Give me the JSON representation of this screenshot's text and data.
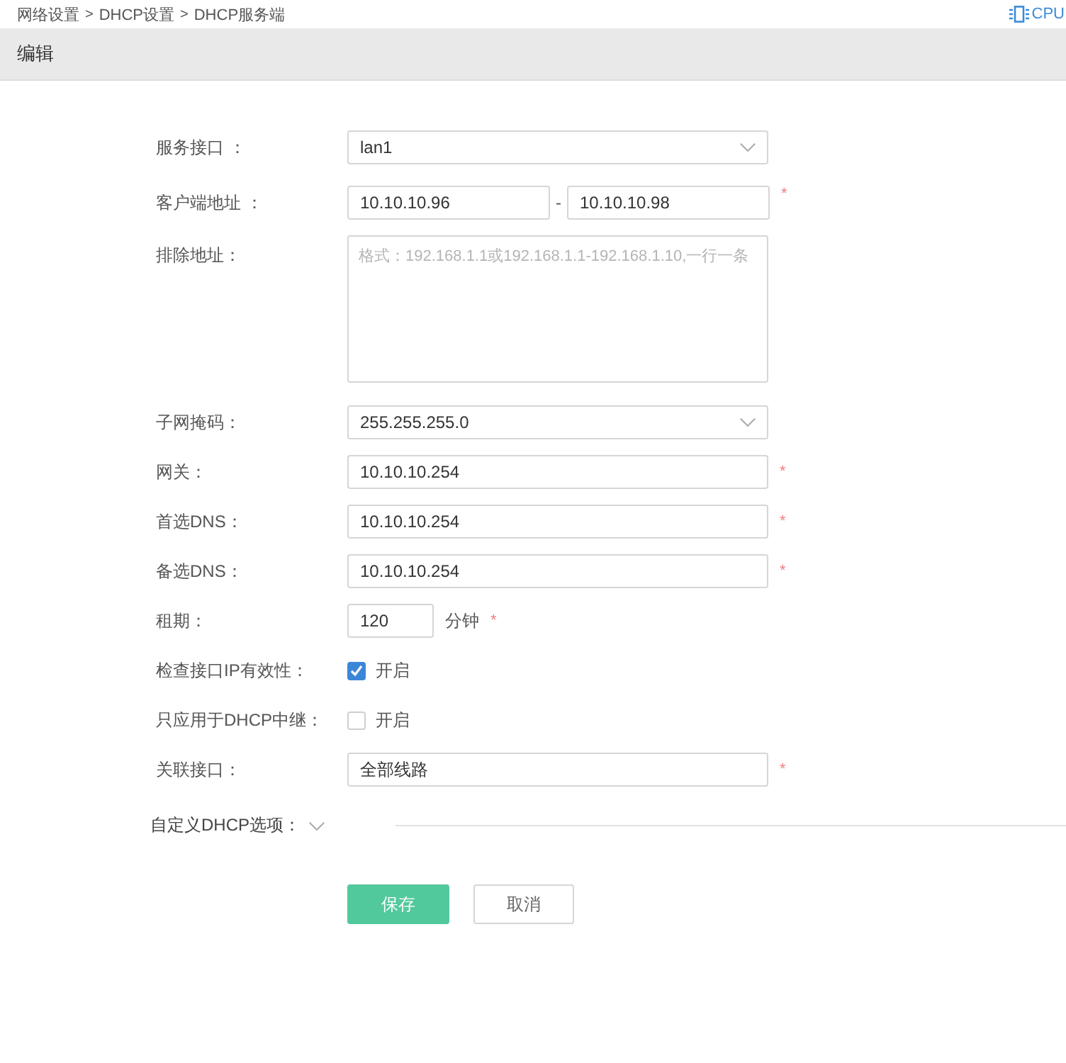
{
  "breadcrumb": {
    "items": [
      "网络设置",
      "DHCP设置",
      "DHCP服务端"
    ],
    "separator": ">"
  },
  "status": {
    "label": "CPU"
  },
  "header": {
    "title": "编辑"
  },
  "form": {
    "rows": [
      {
        "kind": "select",
        "label": "服务接口 ：",
        "value": "lan1"
      },
      {
        "kind": "range",
        "label": "客户端地址 ：",
        "from": "10.10.10.96",
        "separator": "-",
        "to": "10.10.10.98",
        "mark": "*"
      },
      {
        "kind": "textarea",
        "label": "排除地址：",
        "placeholder": "格式：192.168.1.1或192.168.1.1-192.168.1.10,一行一条"
      },
      {
        "kind": "select",
        "label": "子网掩码：",
        "value": "255.255.255.0"
      },
      {
        "kind": "input",
        "label": "网关：",
        "value": "10.10.10.254",
        "mark": "*"
      },
      {
        "kind": "input",
        "label": "首选DNS：",
        "value": "10.10.10.254",
        "mark": "*"
      },
      {
        "kind": "input",
        "label": "备选DNS：",
        "value": "10.10.10.254",
        "mark": "*"
      },
      {
        "kind": "number",
        "label": "租期：",
        "value": "120",
        "unit": "分钟",
        "mark": "*"
      },
      {
        "kind": "checkbox",
        "label": "检查接口IP有效性：",
        "option": "开启",
        "checked": true
      },
      {
        "kind": "checkbox",
        "label": "只应用于DHCP中继：",
        "option": "开启",
        "checked": false
      },
      {
        "kind": "input",
        "label": "关联接口：",
        "value": "全部线路",
        "mark": "*"
      }
    ],
    "collapse": {
      "label": "自定义DHCP选项：",
      "expanded": false
    },
    "buttons": [
      {
        "label": "保存",
        "kind": "primary"
      },
      {
        "label": "取消",
        "kind": "secondary"
      }
    ]
  }
}
